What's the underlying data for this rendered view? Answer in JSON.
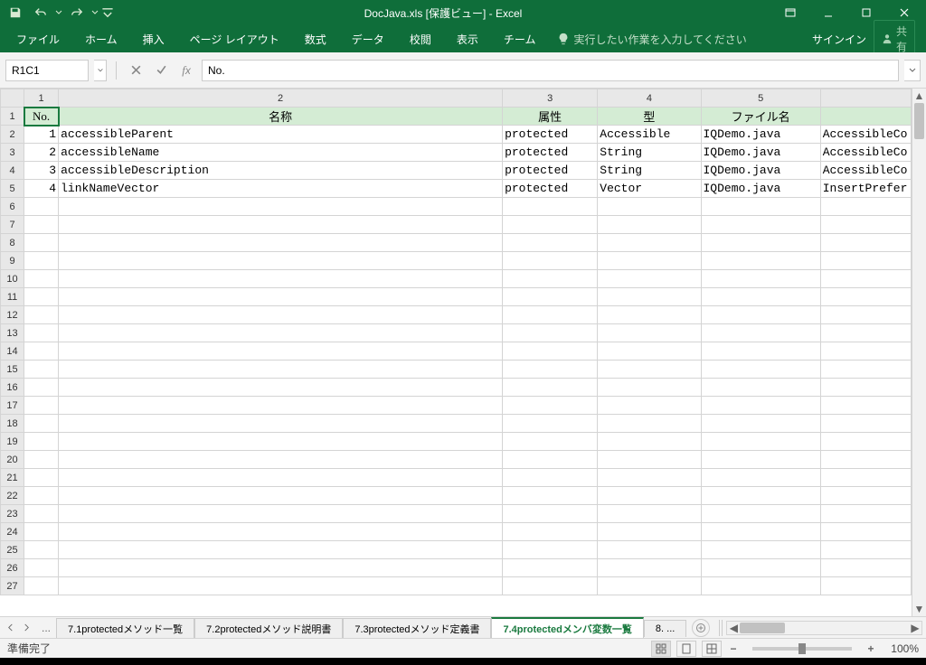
{
  "titlebar": {
    "title": "DocJava.xls  [保護ビュー] - Excel"
  },
  "win": {
    "ribbon_opts": "⋯"
  },
  "ribbon": {
    "file": "ファイル",
    "home": "ホーム",
    "insert": "挿入",
    "layout": "ページ レイアウト",
    "formulas": "数式",
    "data": "データ",
    "review": "校閲",
    "view": "表示",
    "team": "チーム",
    "tellme": "実行したい作業を入力してください",
    "signin": "サインイン",
    "share": "共有"
  },
  "formula_bar": {
    "name_box": "R1C1",
    "formula": "No."
  },
  "columns": [
    "1",
    "2",
    "3",
    "4",
    "5",
    ""
  ],
  "headers": {
    "no": "No.",
    "name": "名称",
    "attr": "属性",
    "type": "型",
    "file": "ファイル名",
    "last": ""
  },
  "rows": [
    {
      "no": "1",
      "name": "accessibleParent",
      "attr": "protected",
      "type": "Accessible",
      "file": "IQDemo.java",
      "last": "AccessibleCo"
    },
    {
      "no": "2",
      "name": "accessibleName",
      "attr": "protected",
      "type": "String",
      "file": "IQDemo.java",
      "last": "AccessibleCo"
    },
    {
      "no": "3",
      "name": "accessibleDescription",
      "attr": "protected",
      "type": "String",
      "file": "IQDemo.java",
      "last": "AccessibleCo"
    },
    {
      "no": "4",
      "name": "linkNameVector",
      "attr": "protected",
      "type": "Vector",
      "file": "IQDemo.java",
      "last": "InsertPrefer"
    }
  ],
  "empty_rows": 22,
  "sheet_tabs": {
    "ellipsis": "...",
    "t1": "7.1protectedメソッド一覧",
    "t2": "7.2protectedメソッド説明書",
    "t3": "7.3protectedメソッド定義書",
    "t4": "7.4protectedメンバ変数一覧",
    "t5": "8. ...",
    "new": "⊕"
  },
  "status": {
    "ready": "準備完了",
    "zoom": "100%"
  }
}
